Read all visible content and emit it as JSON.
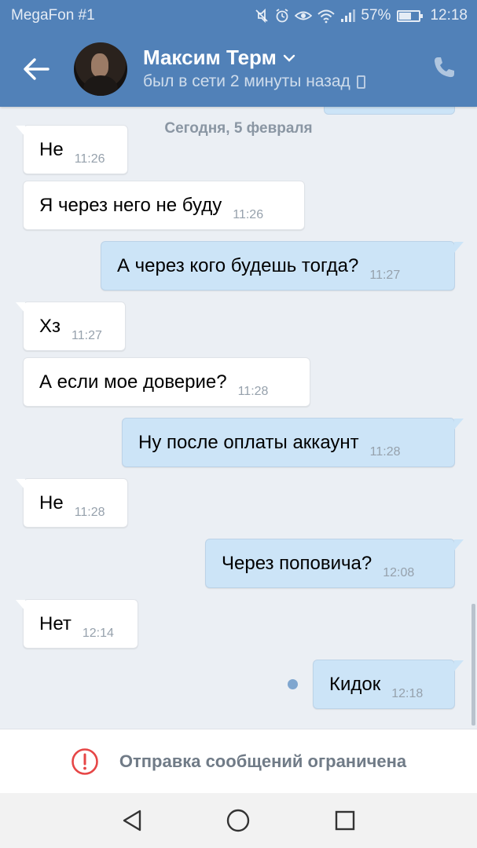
{
  "status_bar": {
    "carrier": "MegaFon #1",
    "battery_percent": "57%",
    "battery_level": 0.57,
    "time": "12:18",
    "icons": [
      "mute-icon",
      "alarm-icon",
      "eye-icon",
      "wifi-icon",
      "signal-icon",
      "battery-icon"
    ]
  },
  "header": {
    "contact_name": "Максим Терм",
    "last_seen": "был в сети 2 минуты назад",
    "accent_color": "#5181b8"
  },
  "chat": {
    "date_divider": "Сегодня, 5 февраля",
    "messages": [
      {
        "direction": "in",
        "text": "Не",
        "time": "11:26"
      },
      {
        "direction": "in",
        "text": "Я через него не буду",
        "time": "11:26"
      },
      {
        "direction": "out",
        "text": "А через кого будешь тогда?",
        "time": "11:27"
      },
      {
        "direction": "in",
        "text": "Хз",
        "time": "11:27"
      },
      {
        "direction": "in",
        "text": "А если мое доверие?",
        "time": "11:28"
      },
      {
        "direction": "out",
        "text": "Ну после оплаты аккаунт",
        "time": "11:28"
      },
      {
        "direction": "in",
        "text": "Не",
        "time": "11:28"
      },
      {
        "direction": "out",
        "text": "Через поповича?",
        "time": "12:08"
      },
      {
        "direction": "in",
        "text": "Нет",
        "time": "12:14"
      },
      {
        "direction": "out",
        "text": "Кидок",
        "time": "12:18",
        "unread": true
      }
    ]
  },
  "restriction": {
    "text": "Отправка сообщений ограничена",
    "icon": "warning-circle-icon",
    "color": "#e64646"
  },
  "nav": {
    "buttons": [
      "back-triangle-icon",
      "home-circle-icon",
      "recents-square-icon"
    ]
  }
}
